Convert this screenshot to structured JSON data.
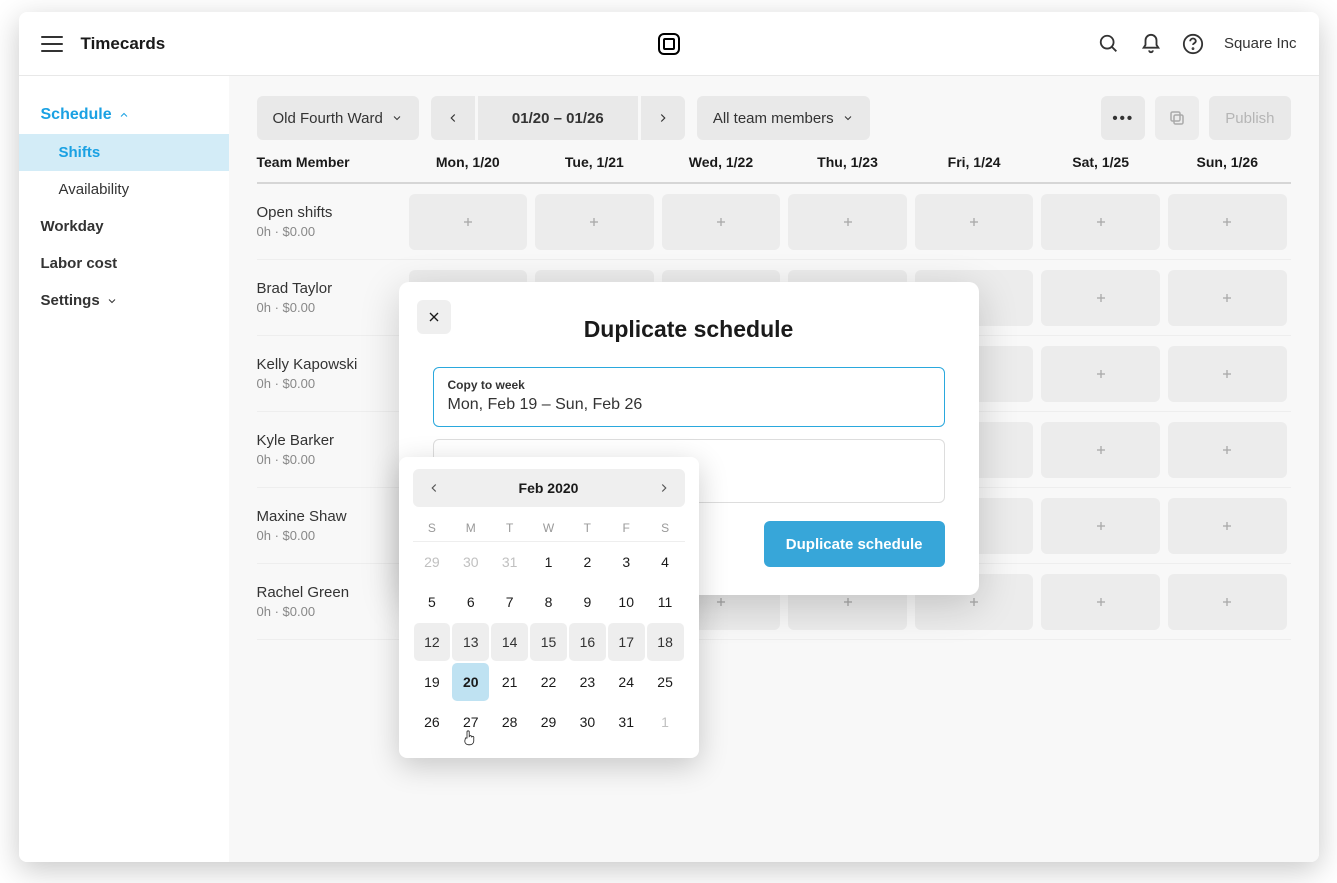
{
  "header": {
    "title": "Timecards",
    "company": "Square Inc"
  },
  "sidebar": {
    "parent": "Schedule",
    "children": [
      "Shifts",
      "Availability"
    ],
    "items": [
      "Workday",
      "Labor cost",
      "Settings"
    ]
  },
  "toolbar": {
    "location": "Old Fourth Ward",
    "date_range": "01/20 – 01/26",
    "team_filter": "All team members",
    "publish": "Publish"
  },
  "grid": {
    "member_header": "Team Member",
    "days": [
      "Mon, 1/20",
      "Tue, 1/21",
      "Wed, 1/22",
      "Thu, 1/23",
      "Fri, 1/24",
      "Sat, 1/25",
      "Sun, 1/26"
    ],
    "rows": [
      {
        "name": "Open shifts",
        "meta": "0h · $0.00"
      },
      {
        "name": "Brad Taylor",
        "meta": "0h · $0.00"
      },
      {
        "name": "Kelly Kapowski",
        "meta": "0h · $0.00"
      },
      {
        "name": "Kyle Barker",
        "meta": "0h · $0.00"
      },
      {
        "name": "Maxine Shaw",
        "meta": "0h · $0.00"
      },
      {
        "name": "Rachel Green",
        "meta": "0h · $0.00"
      }
    ]
  },
  "modal": {
    "title": "Duplicate schedule",
    "field_label": "Copy to week",
    "field_value": "Mon, Feb 19 – Sun, Feb 26",
    "submit": "Duplicate schedule"
  },
  "calendar": {
    "month": "Feb 2020",
    "dow": [
      "S",
      "M",
      "T",
      "W",
      "T",
      "F",
      "S"
    ],
    "cells": [
      {
        "n": 29,
        "other": true
      },
      {
        "n": 30,
        "other": true
      },
      {
        "n": 31,
        "other": true
      },
      {
        "n": 1
      },
      {
        "n": 2
      },
      {
        "n": 3
      },
      {
        "n": 4
      },
      {
        "n": 5
      },
      {
        "n": 6
      },
      {
        "n": 7
      },
      {
        "n": 8
      },
      {
        "n": 9
      },
      {
        "n": 10
      },
      {
        "n": 11
      },
      {
        "n": 12,
        "range": true
      },
      {
        "n": 13,
        "range": true
      },
      {
        "n": 14,
        "range": true
      },
      {
        "n": 15,
        "range": true
      },
      {
        "n": 16,
        "range": true
      },
      {
        "n": 17,
        "range": true
      },
      {
        "n": 18,
        "range": true
      },
      {
        "n": 19
      },
      {
        "n": 20,
        "selected": true
      },
      {
        "n": 21
      },
      {
        "n": 22
      },
      {
        "n": 23
      },
      {
        "n": 24
      },
      {
        "n": 25
      },
      {
        "n": 26
      },
      {
        "n": 27
      },
      {
        "n": 28
      },
      {
        "n": 29
      },
      {
        "n": 30
      },
      {
        "n": 31
      },
      {
        "n": 1,
        "other": true
      }
    ]
  }
}
